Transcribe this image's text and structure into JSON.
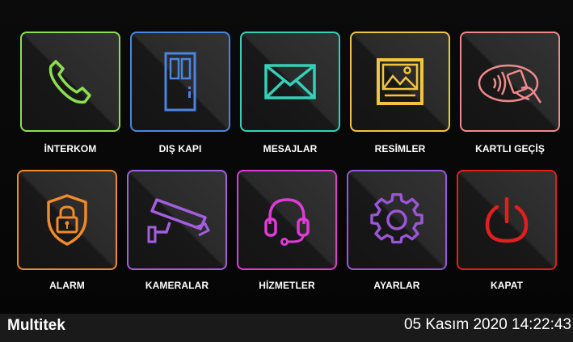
{
  "tiles": [
    {
      "label": "İNTERKOM",
      "icon": "phone-icon",
      "color": "#8be04f"
    },
    {
      "label": "DIŞ KAPI",
      "icon": "door-icon",
      "color": "#4a86e0"
    },
    {
      "label": "MESAJLAR",
      "icon": "envelope-icon",
      "color": "#34d1b8"
    },
    {
      "label": "RESİMLER",
      "icon": "picture-icon",
      "color": "#f2c442"
    },
    {
      "label": "KARTLI GEÇİŞ",
      "icon": "card-reader-icon",
      "color": "#f08a8a"
    },
    {
      "label": "ALARM",
      "icon": "shield-lock-icon",
      "color": "#f08a2a"
    },
    {
      "label": "KAMERALAR",
      "icon": "security-camera-icon",
      "color": "#a45ee0"
    },
    {
      "label": "HİZMETLER",
      "icon": "headset-icon",
      "color": "#e03ad8"
    },
    {
      "label": "AYARLAR",
      "icon": "gear-icon",
      "color": "#9a56d8"
    },
    {
      "label": "KAPAT",
      "icon": "power-icon",
      "color": "#e01f1f"
    }
  ],
  "status_bar": {
    "brand": "Multitek",
    "datetime": "05 Kasım 2020 14:22:43"
  }
}
